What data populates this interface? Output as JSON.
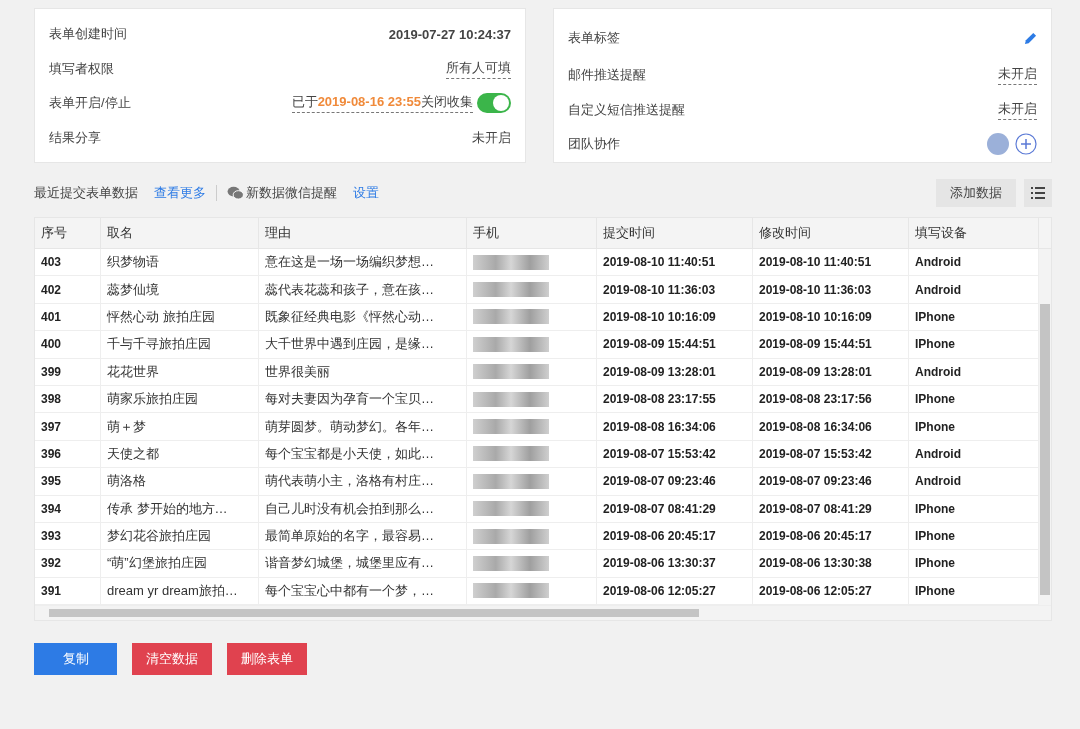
{
  "info_left": [
    {
      "kind": "bold",
      "label": "表单创建时间",
      "value": "2019-07-27 10:24:37"
    },
    {
      "kind": "link",
      "label": "填写者权限",
      "value": "所有人可填"
    },
    {
      "kind": "toggle",
      "label": "表单开启/停止",
      "before": "已于",
      "date": "2019-08-16 23:55",
      "after": "关闭收集",
      "on": true
    },
    {
      "kind": "plain",
      "label": "结果分享",
      "value": "未开启"
    }
  ],
  "info_right": [
    {
      "kind": "edit",
      "label": "表单标签"
    },
    {
      "kind": "link",
      "label": "邮件推送提醒",
      "value": "未开启"
    },
    {
      "kind": "link",
      "label": "自定义短信推送提醒",
      "value": "未开启"
    },
    {
      "kind": "team",
      "label": "团队协作"
    }
  ],
  "toolbar": {
    "title": "最近提交表单数据",
    "more": "查看更多",
    "wechat": "新数据微信提醒",
    "settings": "设置",
    "add": "添加数据"
  },
  "table": {
    "columns": [
      "序号",
      "取名",
      "理由",
      "手机",
      "提交时间",
      "修改时间",
      "填写设备"
    ],
    "rows": [
      {
        "no": "403",
        "name": "织梦物语",
        "reason": "意在这是一场一场编织梦想…",
        "submitted": "2019-08-10 11:40:51",
        "modified": "2019-08-10 11:40:51",
        "device": "Android"
      },
      {
        "no": "402",
        "name": "蕊梦仙境",
        "reason": "蕊代表花蕊和孩子，意在孩…",
        "submitted": "2019-08-10 11:36:03",
        "modified": "2019-08-10 11:36:03",
        "device": "Android"
      },
      {
        "no": "401",
        "name": "怦然心动 旅拍庄园",
        "reason": "既象征经典电影《怦然心动…",
        "submitted": "2019-08-10 10:16:09",
        "modified": "2019-08-10 10:16:09",
        "device": "IPhone"
      },
      {
        "no": "400",
        "name": "千与千寻旅拍庄园",
        "reason": "大千世界中遇到庄园，是缘…",
        "submitted": "2019-08-09 15:44:51",
        "modified": "2019-08-09 15:44:51",
        "device": "IPhone"
      },
      {
        "no": "399",
        "name": "花花世界",
        "reason": "世界很美丽",
        "submitted": "2019-08-09 13:28:01",
        "modified": "2019-08-09 13:28:01",
        "device": "Android"
      },
      {
        "no": "398",
        "name": "萌家乐旅拍庄园",
        "reason": "每对夫妻因为孕育一个宝贝…",
        "submitted": "2019-08-08 23:17:55",
        "modified": "2019-08-08 23:17:56",
        "device": "IPhone"
      },
      {
        "no": "397",
        "name": "萌＋梦",
        "reason": "萌芽圆梦。萌动梦幻。各年…",
        "submitted": "2019-08-08 16:34:06",
        "modified": "2019-08-08 16:34:06",
        "device": "IPhone"
      },
      {
        "no": "396",
        "name": "天使之都",
        "reason": "每个宝宝都是小天使，如此…",
        "submitted": "2019-08-07 15:53:42",
        "modified": "2019-08-07 15:53:42",
        "device": "Android"
      },
      {
        "no": "395",
        "name": "萌洛格",
        "reason": "萌代表萌小主，洛格有村庄…",
        "submitted": "2019-08-07 09:23:46",
        "modified": "2019-08-07 09:23:46",
        "device": "Android"
      },
      {
        "no": "394",
        "name": "传承 梦开始的地方…",
        "reason": "自己儿时没有机会拍到那么…",
        "submitted": "2019-08-07 08:41:29",
        "modified": "2019-08-07 08:41:29",
        "device": "IPhone"
      },
      {
        "no": "393",
        "name": "梦幻花谷旅拍庄园",
        "reason": "最简单原始的名字，最容易…",
        "submitted": "2019-08-06 20:45:17",
        "modified": "2019-08-06 20:45:17",
        "device": "IPhone"
      },
      {
        "no": "392",
        "name": "“萌”幻堡旅拍庄园",
        "reason": "谐音梦幻城堡，城堡里应有…",
        "submitted": "2019-08-06 13:30:37",
        "modified": "2019-08-06 13:30:38",
        "device": "IPhone"
      },
      {
        "no": "391",
        "name": "dream yr dream旅拍…",
        "reason": "每个宝宝心中都有一个梦，…",
        "submitted": "2019-08-06 12:05:27",
        "modified": "2019-08-06 12:05:27",
        "device": "IPhone"
      }
    ]
  },
  "buttons": [
    {
      "label": "复制",
      "kind": "primary"
    },
    {
      "label": "清空数据",
      "kind": "danger"
    },
    {
      "label": "删除表单",
      "kind": "danger"
    }
  ]
}
